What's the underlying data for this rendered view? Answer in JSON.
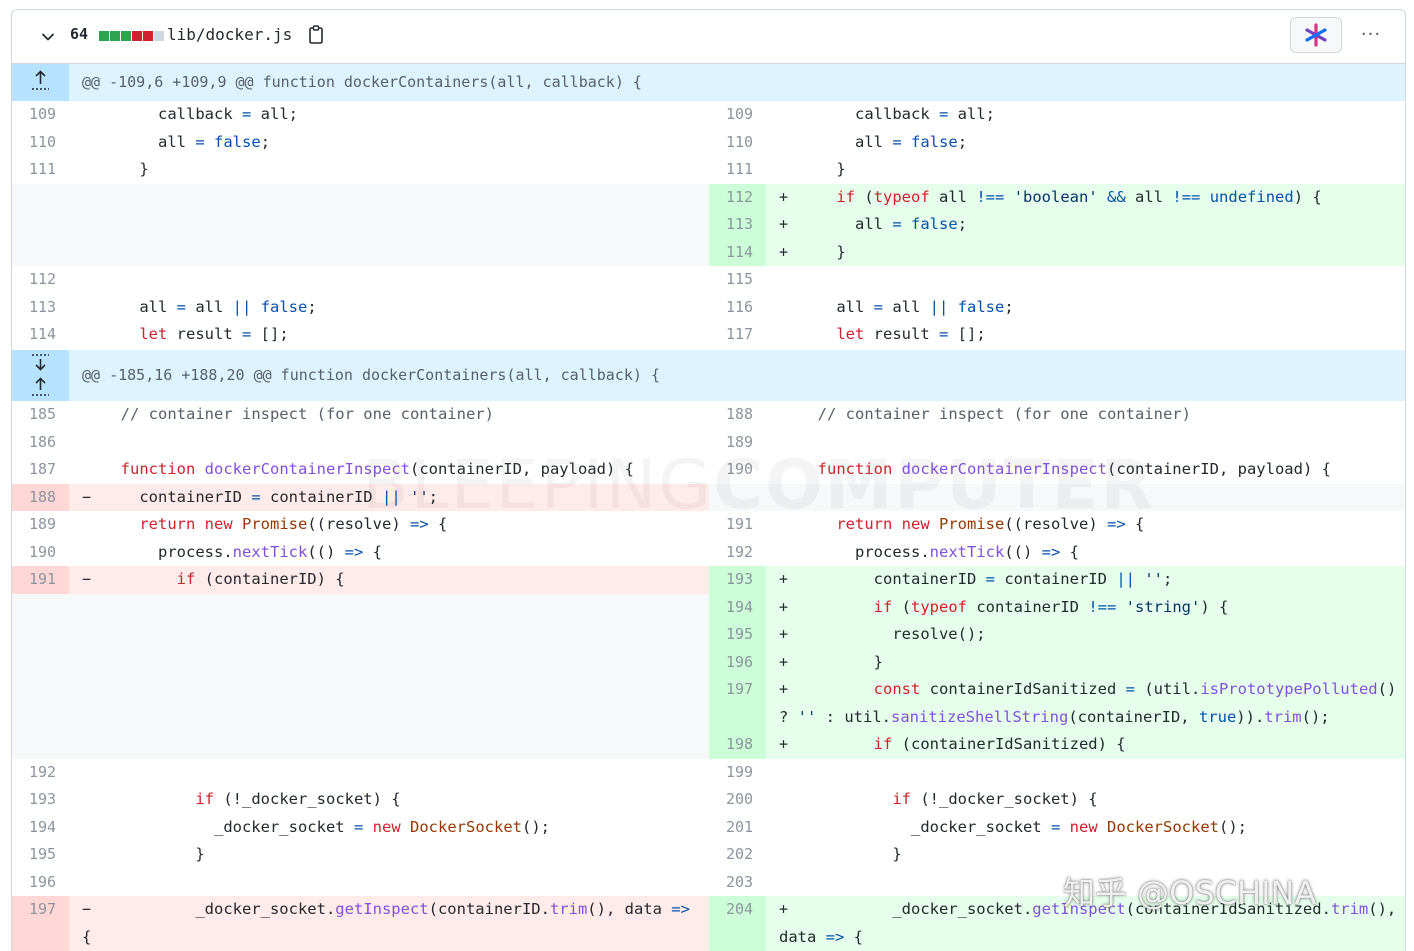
{
  "file": {
    "changes": "64",
    "path": "lib/docker.js",
    "diffstat_colors": [
      "#2da44e",
      "#2da44e",
      "#2da44e",
      "#cf222e",
      "#cf222e",
      "#d0d7de"
    ]
  },
  "colors": {
    "add_bg": "#e6ffec",
    "add_num_bg": "#ccffd8",
    "del_bg": "#ffebe9",
    "del_num_bg": "#ffd7d5",
    "empty_bg": "#f6f8fa",
    "hunk_bg": "#ddf4ff",
    "keyword": "#cf222e",
    "function": "#8250df",
    "constant": "#0550ae",
    "string": "#0a3069"
  },
  "icons": {
    "chevron": "chevron-down-icon",
    "copy": "copy-icon",
    "ai": "copilot-icon",
    "more": "kebab-horizontal-icon",
    "expand_up": "fold-up-icon",
    "expand_down": "fold-down-icon"
  },
  "more_label": "···",
  "hunks": [
    "@@ -109,6 +109,9 @@ function dockerContainers(all, callback) {",
    "@@ -185,16 +188,20 @@ function dockerContainers(all, callback) {"
  ],
  "watermark": {
    "left": "BLEEPING",
    "right": "COMPUTER"
  },
  "credit": "知乎 @OSCHINA",
  "rows": [
    {
      "l": {
        "n": "109",
        "t": "      callback = all;"
      },
      "r": {
        "n": "109",
        "t": "      callback = all;"
      }
    },
    {
      "l": {
        "n": "110",
        "t": "      all = false;"
      },
      "r": {
        "n": "110",
        "t": "      all = false;"
      }
    },
    {
      "l": {
        "n": "111",
        "t": "    }"
      },
      "r": {
        "n": "111",
        "t": "    }"
      }
    },
    {
      "l": null,
      "r": {
        "n": "112",
        "t": "    if (typeof all !== 'boolean' && all !== undefined) {",
        "k": "add"
      }
    },
    {
      "l": null,
      "r": {
        "n": "113",
        "t": "      all = false;",
        "k": "add"
      }
    },
    {
      "l": null,
      "r": {
        "n": "114",
        "t": "    }",
        "k": "add"
      }
    },
    {
      "l": {
        "n": "112",
        "t": ""
      },
      "r": {
        "n": "115",
        "t": ""
      }
    },
    {
      "l": {
        "n": "113",
        "t": "    all = all || false;"
      },
      "r": {
        "n": "116",
        "t": "    all = all || false;"
      }
    },
    {
      "l": {
        "n": "114",
        "t": "    let result = [];"
      },
      "r": {
        "n": "117",
        "t": "    let result = [];"
      }
    },
    {
      "l": {
        "n": "185",
        "t": "  // container inspect (for one container)"
      },
      "r": {
        "n": "188",
        "t": "  // container inspect (for one container)"
      }
    },
    {
      "l": {
        "n": "186",
        "t": ""
      },
      "r": {
        "n": "189",
        "t": ""
      }
    },
    {
      "l": {
        "n": "187",
        "t": "  function dockerContainerInspect(containerID, payload) {"
      },
      "r": {
        "n": "190",
        "t": "  function dockerContainerInspect(containerID, payload) {"
      }
    },
    {
      "l": {
        "n": "188",
        "t": "    containerID = containerID || '';",
        "k": "del"
      },
      "r": null
    },
    {
      "l": {
        "n": "189",
        "t": "    return new Promise((resolve) => {"
      },
      "r": {
        "n": "191",
        "t": "    return new Promise((resolve) => {"
      }
    },
    {
      "l": {
        "n": "190",
        "t": "      process.nextTick(() => {"
      },
      "r": {
        "n": "192",
        "t": "      process.nextTick(() => {"
      }
    },
    {
      "l": {
        "n": "191",
        "t": "        if (containerID) {",
        "k": "del"
      },
      "r": {
        "n": "193",
        "t": "        containerID = containerID || '';",
        "k": "add"
      }
    },
    {
      "l": null,
      "r": {
        "n": "194",
        "t": "        if (typeof containerID !== 'string') {",
        "k": "add"
      }
    },
    {
      "l": null,
      "r": {
        "n": "195",
        "t": "          resolve();",
        "k": "add"
      }
    },
    {
      "l": null,
      "r": {
        "n": "196",
        "t": "        }",
        "k": "add"
      }
    },
    {
      "l": null,
      "r": {
        "n": "197",
        "t": "        const containerIdSanitized = (util.isPrototypePolluted()",
        "t2": "? '' : util.sanitizeShellString(containerID, true)).trim();",
        "k": "add"
      }
    },
    {
      "l": null,
      "r": {
        "n": "198",
        "t": "        if (containerIdSanitized) {",
        "k": "add"
      }
    },
    {
      "l": {
        "n": "192",
        "t": ""
      },
      "r": {
        "n": "199",
        "t": ""
      }
    },
    {
      "l": {
        "n": "193",
        "t": "          if (!_docker_socket) {"
      },
      "r": {
        "n": "200",
        "t": "          if (!_docker_socket) {"
      }
    },
    {
      "l": {
        "n": "194",
        "t": "            _docker_socket = new DockerSocket();"
      },
      "r": {
        "n": "201",
        "t": "            _docker_socket = new DockerSocket();"
      }
    },
    {
      "l": {
        "n": "195",
        "t": "          }"
      },
      "r": {
        "n": "202",
        "t": "          }"
      }
    },
    {
      "l": {
        "n": "196",
        "t": ""
      },
      "r": {
        "n": "203",
        "t": ""
      }
    },
    {
      "l": {
        "n": "197",
        "t": "          _docker_socket.getInspect(containerID.trim(), data =>",
        "t2": "{",
        "k": "del"
      },
      "r": {
        "n": "204",
        "t": "          _docker_socket.getInspect(containerIdSanitized.trim(),",
        "t2": "data => {",
        "k": "add"
      }
    }
  ]
}
